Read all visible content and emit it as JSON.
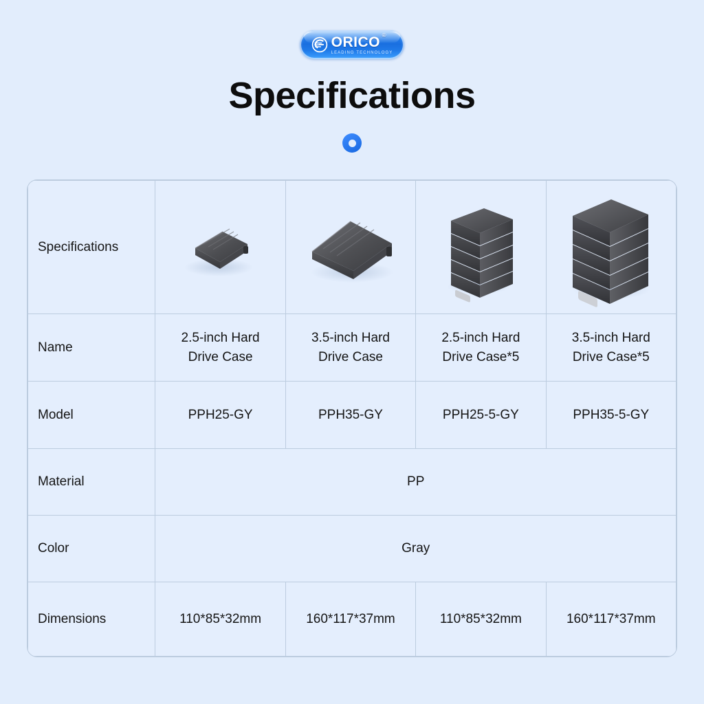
{
  "brand": {
    "name": "ORICO",
    "registered": "®",
    "tagline": "LEADING TECHNOLOGY",
    "logo_icon": "orico-globe-icon",
    "pill_color": "#1a6fe0"
  },
  "header": {
    "title": "Specifications",
    "divider_icon": "blue-ring-icon",
    "divider_color": "#1667e0"
  },
  "theme": {
    "background": "#e2edfc",
    "table_background": "#e4eefd",
    "border": "#bcccdf",
    "text": "#141414",
    "product_body": "#4a4a4c",
    "product_label": "#d8dade"
  },
  "table": {
    "row_header_label": "Specifications",
    "products": [
      {
        "image_icon": "hard-drive-case-2-5-inch-icon",
        "name": "2.5-inch Hard\nDrive Case",
        "name_line1": "2.5-inch Hard",
        "name_line2": "Drive Case",
        "model": "PPH25-GY",
        "dimensions": "110*85*32mm"
      },
      {
        "image_icon": "hard-drive-case-3-5-inch-icon",
        "name": "3.5-inch Hard\nDrive Case",
        "name_line1": "3.5-inch Hard",
        "name_line2": "Drive Case",
        "model": "PPH35-GY",
        "dimensions": "160*117*37mm"
      },
      {
        "image_icon": "hard-drive-case-2-5-inch-stack5-icon",
        "name": "2.5-inch Hard\nDrive Case*5",
        "name_line1": "2.5-inch Hard",
        "name_line2": "Drive Case*5",
        "model": "PPH25-5-GY",
        "dimensions": "110*85*32mm"
      },
      {
        "image_icon": "hard-drive-case-3-5-inch-stack5-icon",
        "name": "3.5-inch Hard\nDrive Case*5",
        "name_line1": "3.5-inch Hard",
        "name_line2": "Drive Case*5",
        "model": "PPH35-5-GY",
        "dimensions": "160*117*37mm"
      }
    ],
    "rows": {
      "name": {
        "label": "Name"
      },
      "model": {
        "label": "Model"
      },
      "material": {
        "label": "Material",
        "value": "PP"
      },
      "color": {
        "label": "Color",
        "value": "Gray"
      },
      "dimensions": {
        "label": "Dimensions"
      }
    }
  }
}
